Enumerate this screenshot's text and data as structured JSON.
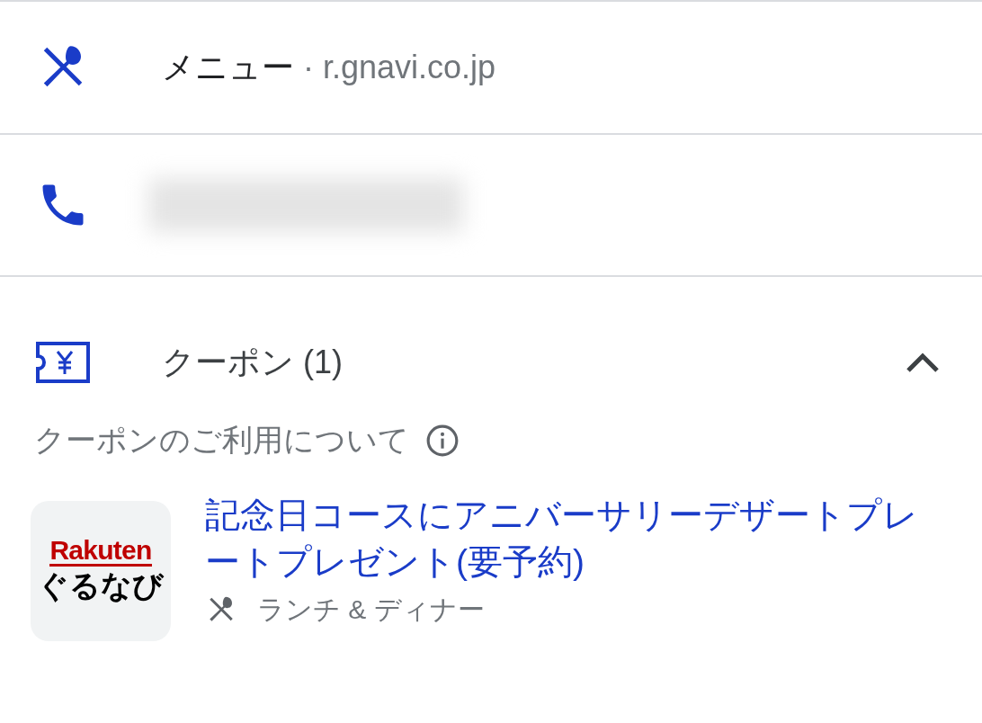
{
  "menu_row": {
    "label": "メニュー",
    "separator": "·",
    "source": "r.gnavi.co.jp"
  },
  "phone_row": {
    "redacted": true
  },
  "coupon_row": {
    "label": "クーポン (1)",
    "expanded": true
  },
  "coupon_info": {
    "label": "クーポンのご利用について"
  },
  "coupons": [
    {
      "logo_top": "Rakuten",
      "logo_bottom": "ぐるなび",
      "title": "記念日コースにアニバーサリーデザートプレートプレゼント(要予約)",
      "meal": "ランチ & ディナー"
    }
  ]
}
